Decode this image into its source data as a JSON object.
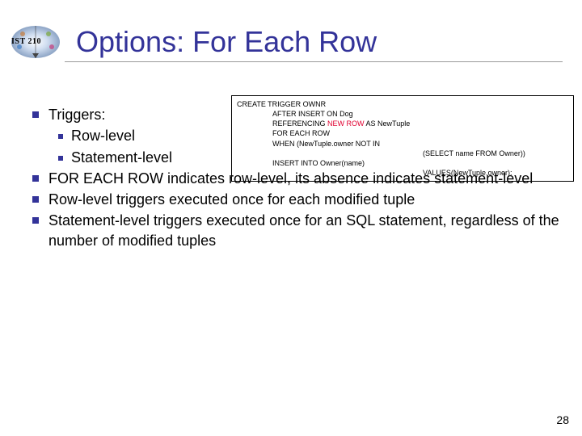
{
  "header": {
    "logo_label": "IST 210",
    "title": "Options: For Each Row"
  },
  "codebox": {
    "l1": "CREATE TRIGGER OWNR",
    "l2a": "AFTER INSERT ON Dog",
    "l2b_pre": "REFERENCING ",
    "l2b_new": "NEW ROW ",
    "l2b_post": "AS NewTuple",
    "l2c": "FOR EACH ROW",
    "l2d": "WHEN (NewTuple.owner NOT IN",
    "l3": "(SELECT name FROM Owner))",
    "l4a": "INSERT INTO Owner(name)",
    "l4b": "VALUES(NewTuple.owner);"
  },
  "bullets": {
    "b1": "Triggers:",
    "b1a": "Row-level",
    "b1b": "Statement-level",
    "b2": "FOR EACH ROW indicates row-level, its absence indicates statement-level",
    "b3": "Row-level triggers executed once for each modified tuple",
    "b4": "Statement-level triggers executed once for an SQL statement, regardless of the number of modified tuples"
  },
  "slide_number": "28"
}
